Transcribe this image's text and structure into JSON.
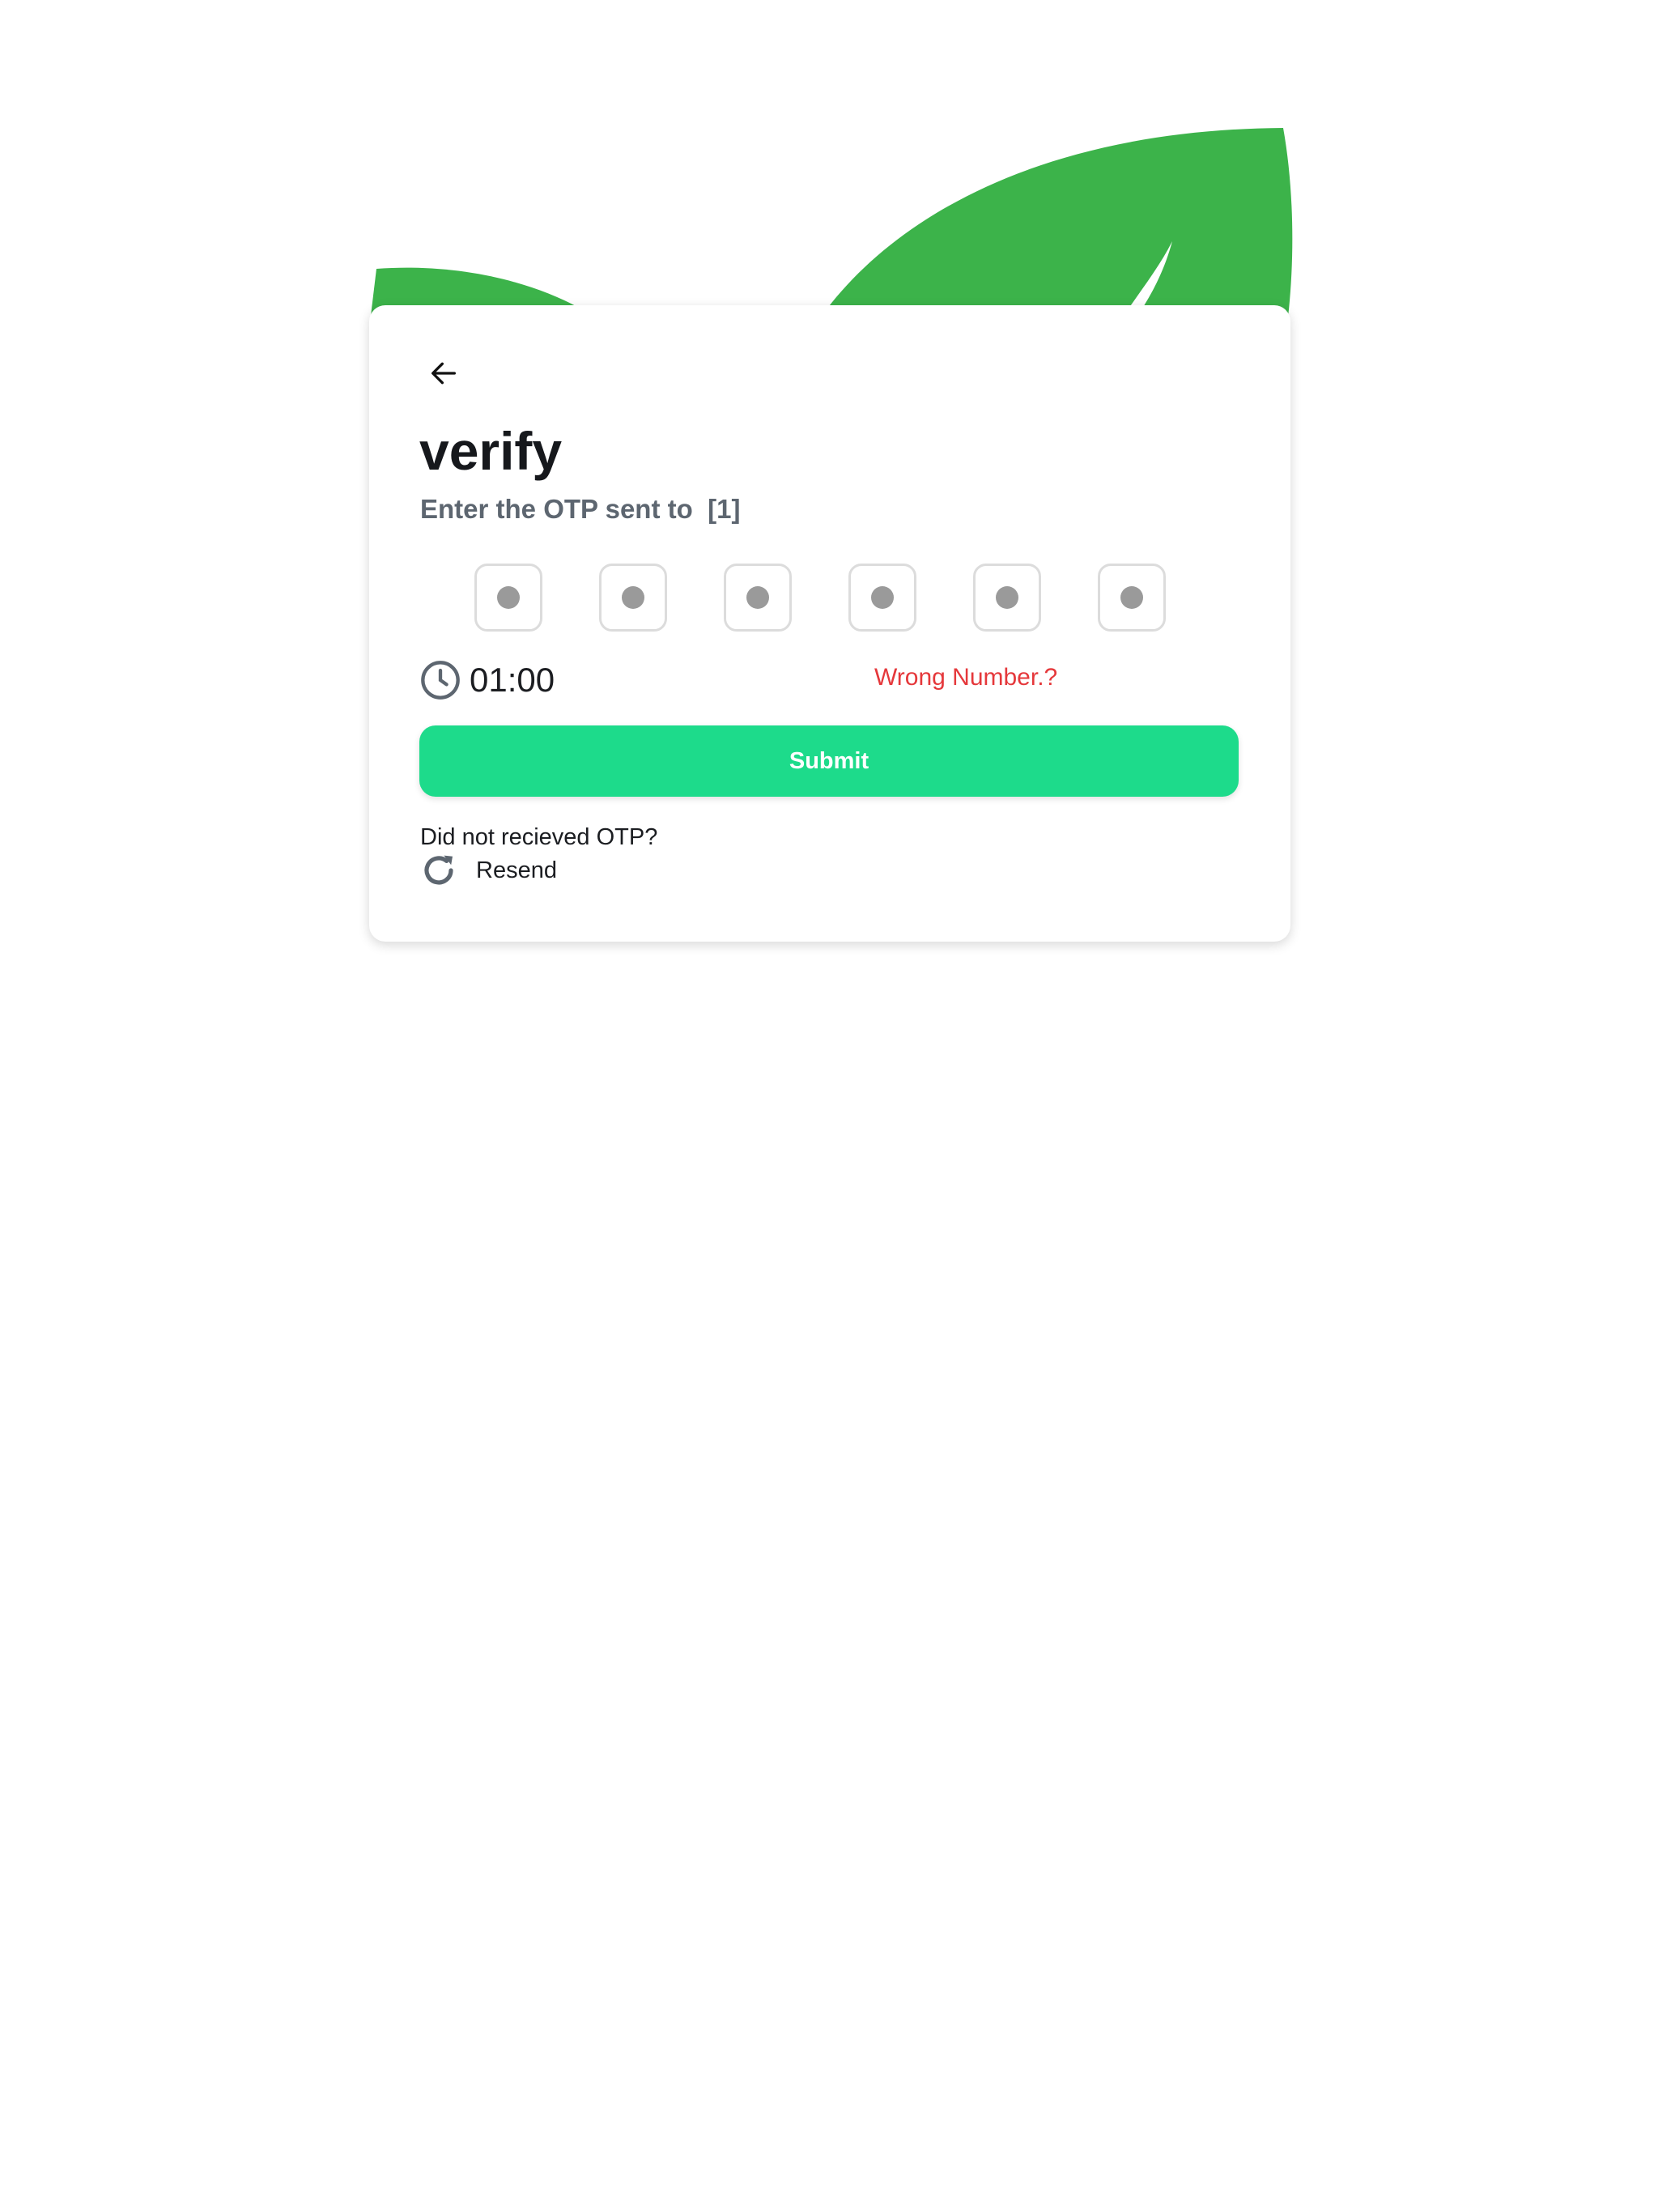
{
  "screen": {
    "title": "verify",
    "subtitle": "Enter the OTP sent to  [1]",
    "otp_digit_count": 6,
    "timer": "01:00",
    "wrong_number_link": "Wrong Number.?",
    "submit_label": "Submit",
    "resend_hint": "Did not recieved OTP?",
    "resend_label": "Resend"
  },
  "colors": {
    "leaf": "#3cb34a",
    "primary_button": "#1ddb8b",
    "link_error": "#e5383b",
    "subtitle": "#5d6670",
    "otp_placeholder_dot": "#9a9a9a"
  },
  "icons": {
    "back": "arrow-left-icon",
    "timer": "clock-icon",
    "resend": "refresh-icon"
  }
}
